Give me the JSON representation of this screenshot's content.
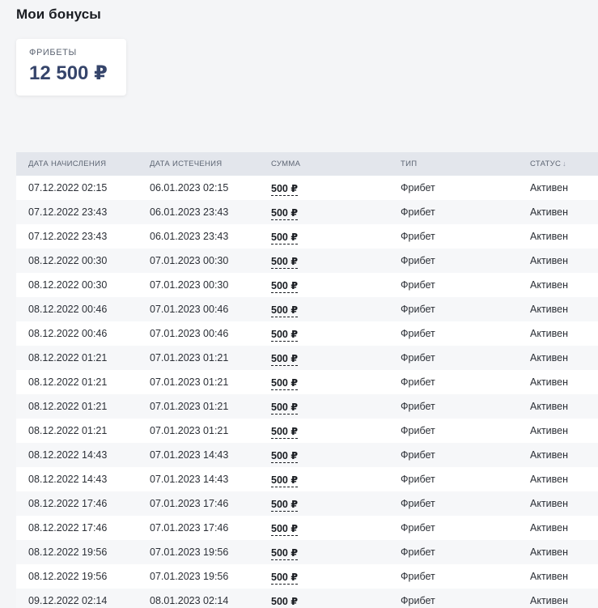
{
  "page_title": "Мои бонусы",
  "balance_card": {
    "label": "ФРИБЕТЫ",
    "value": "12 500 ₽"
  },
  "table": {
    "headers": [
      "ДАТА НАЧИСЛЕНИЯ",
      "ДАТА ИСТЕЧЕНИЯ",
      "СУММА",
      "ТИП",
      "СТАТУС"
    ],
    "sort_icon": "↓",
    "rows": [
      [
        "07.12.2022 02:15",
        "06.01.2023 02:15",
        "500 ₽",
        "Фрибет",
        "Активен"
      ],
      [
        "07.12.2022 23:43",
        "06.01.2023 23:43",
        "500 ₽",
        "Фрибет",
        "Активен"
      ],
      [
        "07.12.2022 23:43",
        "06.01.2023 23:43",
        "500 ₽",
        "Фрибет",
        "Активен"
      ],
      [
        "08.12.2022 00:30",
        "07.01.2023 00:30",
        "500 ₽",
        "Фрибет",
        "Активен"
      ],
      [
        "08.12.2022 00:30",
        "07.01.2023 00:30",
        "500 ₽",
        "Фрибет",
        "Активен"
      ],
      [
        "08.12.2022 00:46",
        "07.01.2023 00:46",
        "500 ₽",
        "Фрибет",
        "Активен"
      ],
      [
        "08.12.2022 00:46",
        "07.01.2023 00:46",
        "500 ₽",
        "Фрибет",
        "Активен"
      ],
      [
        "08.12.2022 01:21",
        "07.01.2023 01:21",
        "500 ₽",
        "Фрибет",
        "Активен"
      ],
      [
        "08.12.2022 01:21",
        "07.01.2023 01:21",
        "500 ₽",
        "Фрибет",
        "Активен"
      ],
      [
        "08.12.2022 01:21",
        "07.01.2023 01:21",
        "500 ₽",
        "Фрибет",
        "Активен"
      ],
      [
        "08.12.2022 01:21",
        "07.01.2023 01:21",
        "500 ₽",
        "Фрибет",
        "Активен"
      ],
      [
        "08.12.2022 14:43",
        "07.01.2023 14:43",
        "500 ₽",
        "Фрибет",
        "Активен"
      ],
      [
        "08.12.2022 14:43",
        "07.01.2023 14:43",
        "500 ₽",
        "Фрибет",
        "Активен"
      ],
      [
        "08.12.2022 17:46",
        "07.01.2023 17:46",
        "500 ₽",
        "Фрибет",
        "Активен"
      ],
      [
        "08.12.2022 17:46",
        "07.01.2023 17:46",
        "500 ₽",
        "Фрибет",
        "Активен"
      ],
      [
        "08.12.2022 19:56",
        "07.01.2023 19:56",
        "500 ₽",
        "Фрибет",
        "Активен"
      ],
      [
        "08.12.2022 19:56",
        "07.01.2023 19:56",
        "500 ₽",
        "Фрибет",
        "Активен"
      ],
      [
        "09.12.2022 02:14",
        "08.01.2023 02:14",
        "500 ₽",
        "Фрибет",
        "Активен"
      ]
    ]
  }
}
